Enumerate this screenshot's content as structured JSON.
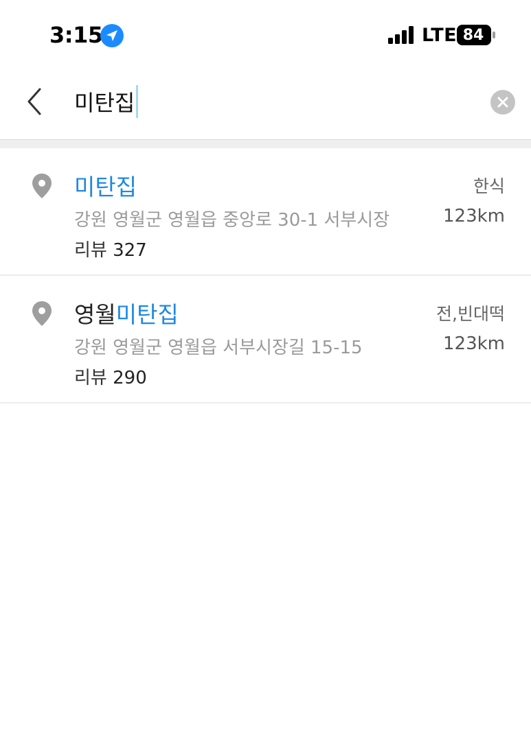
{
  "status": {
    "time": "3:15",
    "network": "LTE",
    "battery": "84"
  },
  "search": {
    "query": "미탄집"
  },
  "icons": {
    "location": "location-arrow-icon",
    "back": "chevron-left-icon",
    "clear": "clear-circle-icon",
    "pin": "map-pin-icon"
  },
  "colors": {
    "accent": "#1e88e5",
    "location_badge": "#1a8cff"
  },
  "results": [
    {
      "name_prefix": "",
      "name_highlight": "미탄집",
      "category": "한식",
      "address": "강원 영월군 영월읍 중앙로 30-1 서부시장",
      "distance": "123km",
      "review_label": "리뷰",
      "review_count": "327"
    },
    {
      "name_prefix": "영월",
      "name_highlight": "미탄집",
      "category": "전,빈대떡",
      "address": "강원 영월군 영월읍 서부시장길 15-15",
      "distance": "123km",
      "review_label": "리뷰",
      "review_count": "290"
    }
  ]
}
